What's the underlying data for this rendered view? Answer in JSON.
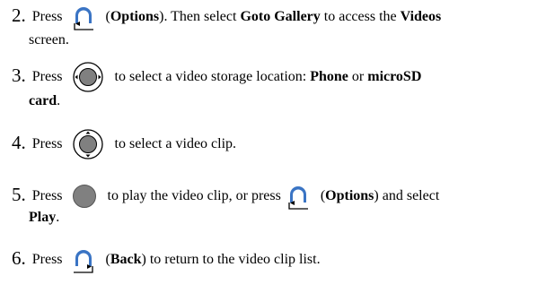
{
  "steps": [
    {
      "number": "2.",
      "press": "Press",
      "icon": "options-soft-key-icon",
      "after_icon": "(",
      "bold1": "Options",
      "mid1": "). Then select ",
      "bold2": "Goto Gallery",
      "mid2": " to access the ",
      "bold3": "Videos",
      "cont": "screen."
    },
    {
      "number": "3.",
      "press": "Press",
      "icon": "navigation-key-left-right-icon",
      "text1": "to select a video storage location: ",
      "bold1": "Phone",
      "text2": " or ",
      "bold2": "microSD",
      "cont_bold": "card",
      "cont_tail": "."
    },
    {
      "number": "4.",
      "press": "Press",
      "icon": "navigation-key-up-down-icon",
      "text1": "to select a video clip."
    },
    {
      "number": "5.",
      "press": "Press",
      "icon": "center-select-key-icon",
      "text1": "to play the video clip, or press ",
      "icon2": "options-soft-key-icon",
      "text2": "(",
      "bold1": "Options",
      "text3": ") and select",
      "cont_bold": "Play",
      "cont_tail": "."
    },
    {
      "number": "6.",
      "press": "Press",
      "icon": "back-soft-key-icon",
      "text1": "(",
      "bold1": "Back",
      "text2": ") to return to the video clip list."
    }
  ]
}
